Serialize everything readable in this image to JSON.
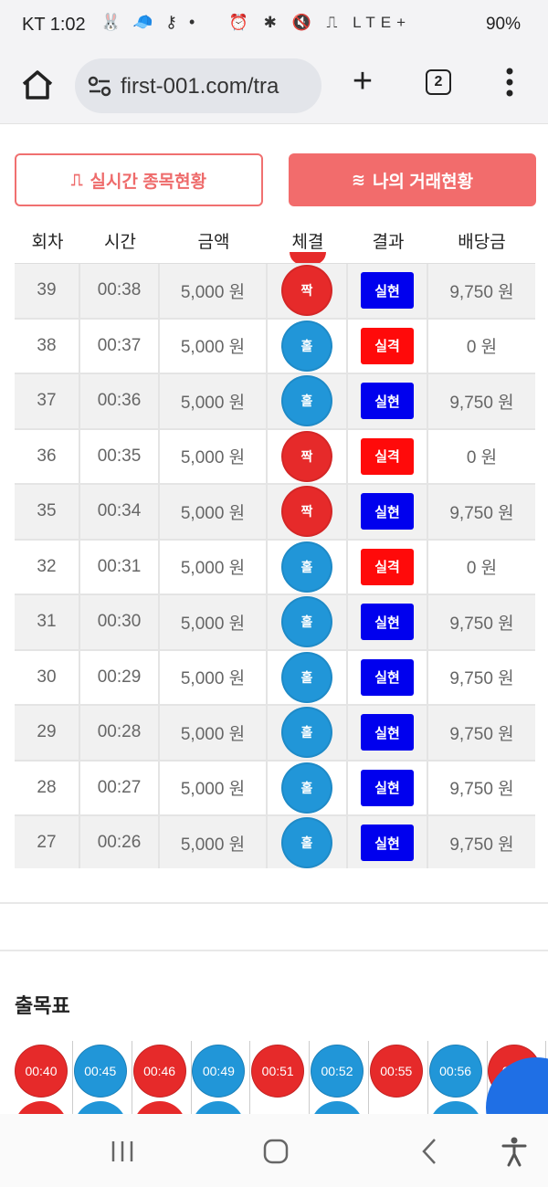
{
  "status_bar": {
    "carrier_time": "KT 1:02",
    "battery": "90%",
    "network": "LTE+"
  },
  "browser": {
    "url": "first-001.com/tra",
    "tab_count": "2"
  },
  "tabs": [
    {
      "label": "실시간 종목현황",
      "icon": "pulse-icon"
    },
    {
      "label": "나의 거래현황",
      "icon": "waves-icon"
    }
  ],
  "table": {
    "headers": [
      "회차",
      "시간",
      "금액",
      "체결",
      "결과",
      "배당금"
    ],
    "rows": [
      {
        "round": "39",
        "time": "00:38",
        "amount": "5,000 원",
        "bet": "짝",
        "bet_color": "red",
        "result": "실현",
        "result_type": "win",
        "payout": "9,750 원"
      },
      {
        "round": "38",
        "time": "00:37",
        "amount": "5,000 원",
        "bet": "홀",
        "bet_color": "blue",
        "result": "실격",
        "result_type": "lose",
        "payout": "0 원"
      },
      {
        "round": "37",
        "time": "00:36",
        "amount": "5,000 원",
        "bet": "홀",
        "bet_color": "blue",
        "result": "실현",
        "result_type": "win",
        "payout": "9,750 원"
      },
      {
        "round": "36",
        "time": "00:35",
        "amount": "5,000 원",
        "bet": "짝",
        "bet_color": "red",
        "result": "실격",
        "result_type": "lose",
        "payout": "0 원"
      },
      {
        "round": "35",
        "time": "00:34",
        "amount": "5,000 원",
        "bet": "짝",
        "bet_color": "red",
        "result": "실현",
        "result_type": "win",
        "payout": "9,750 원"
      },
      {
        "round": "32",
        "time": "00:31",
        "amount": "5,000 원",
        "bet": "홀",
        "bet_color": "blue",
        "result": "실격",
        "result_type": "lose",
        "payout": "0 원"
      },
      {
        "round": "31",
        "time": "00:30",
        "amount": "5,000 원",
        "bet": "홀",
        "bet_color": "blue",
        "result": "실현",
        "result_type": "win",
        "payout": "9,750 원"
      },
      {
        "round": "30",
        "time": "00:29",
        "amount": "5,000 원",
        "bet": "홀",
        "bet_color": "blue",
        "result": "실현",
        "result_type": "win",
        "payout": "9,750 원"
      },
      {
        "round": "29",
        "time": "00:28",
        "amount": "5,000 원",
        "bet": "홀",
        "bet_color": "blue",
        "result": "실현",
        "result_type": "win",
        "payout": "9,750 원"
      },
      {
        "round": "28",
        "time": "00:27",
        "amount": "5,000 원",
        "bet": "홀",
        "bet_color": "blue",
        "result": "실현",
        "result_type": "win",
        "payout": "9,750 원"
      },
      {
        "round": "27",
        "time": "00:26",
        "amount": "5,000 원",
        "bet": "홀",
        "bet_color": "blue",
        "result": "실현",
        "result_type": "win",
        "payout": "9,750 원"
      }
    ]
  },
  "section": {
    "title": "출목표"
  },
  "draw_chart": [
    {
      "time": "00:40",
      "color": "red",
      "below": "red"
    },
    {
      "time": "00:45",
      "color": "blue",
      "below": "blue"
    },
    {
      "time": "00:46",
      "color": "red",
      "below": "red"
    },
    {
      "time": "00:49",
      "color": "blue",
      "below": "blue"
    },
    {
      "time": "00:51",
      "color": "red",
      "below": ""
    },
    {
      "time": "00:52",
      "color": "blue",
      "below": "blue"
    },
    {
      "time": "00:55",
      "color": "red",
      "below": ""
    },
    {
      "time": "00:56",
      "color": "blue",
      "below": "blue"
    },
    {
      "time": "01:0",
      "color": "red",
      "below": ""
    }
  ],
  "colors": {
    "accent": "#f26c6c",
    "odd": "#2196d8",
    "even": "#e62a2a",
    "win": "#0000ee",
    "lose": "#ff0a0a"
  }
}
